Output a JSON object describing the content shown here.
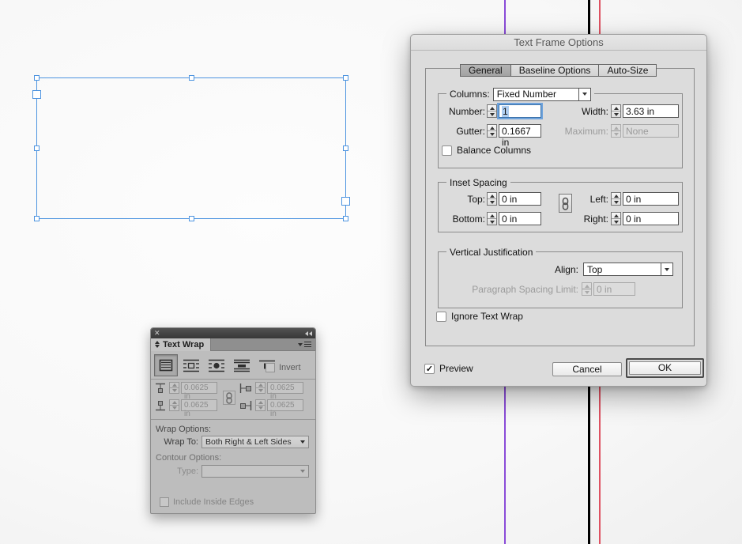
{
  "dialog": {
    "title": "Text Frame Options",
    "tabs": {
      "general": "General",
      "baseline": "Baseline Options",
      "autosize": "Auto-Size"
    },
    "columns": {
      "legend_label": "Columns:",
      "mode_value": "Fixed Number",
      "number_label": "Number:",
      "number_value": "1",
      "width_label": "Width:",
      "width_value": "3.63 in",
      "gutter_label": "Gutter:",
      "gutter_value": "0.1667 in",
      "maximum_label": "Maximum:",
      "maximum_value": "None",
      "balance_label": "Balance Columns"
    },
    "inset": {
      "legend": "Inset Spacing",
      "top_label": "Top:",
      "top_value": "0 in",
      "bottom_label": "Bottom:",
      "bottom_value": "0 in",
      "left_label": "Left:",
      "left_value": "0 in",
      "right_label": "Right:",
      "right_value": "0 in"
    },
    "vertical_justification": {
      "legend": "Vertical Justification",
      "align_label": "Align:",
      "align_value": "Top",
      "psl_label": "Paragraph Spacing Limit:",
      "psl_value": "0 in"
    },
    "ignore_text_wrap_label": "Ignore Text Wrap",
    "preview_label": "Preview",
    "cancel_label": "Cancel",
    "ok_label": "OK"
  },
  "text_wrap_panel": {
    "tab_title": "Text Wrap",
    "invert_label": "Invert",
    "offsets": {
      "top": "0.0625 in",
      "bottom": "0.0625 in",
      "left": "0.0625 in",
      "right": "0.0625 in"
    },
    "wrap_options_label": "Wrap Options:",
    "wrap_to_label": "Wrap To:",
    "wrap_to_value": "Both Right & Left Sides",
    "contour_options_label": "Contour Options:",
    "type_label": "Type:",
    "include_inside_edges_label": "Include Inside Edges"
  },
  "colors": {
    "selection_blue": "#4d94e0",
    "guide_purple": "#8a4bd8",
    "guide_black": "#000000",
    "guide_red": "#de5262",
    "focus_ring": "#6fa3dc"
  }
}
